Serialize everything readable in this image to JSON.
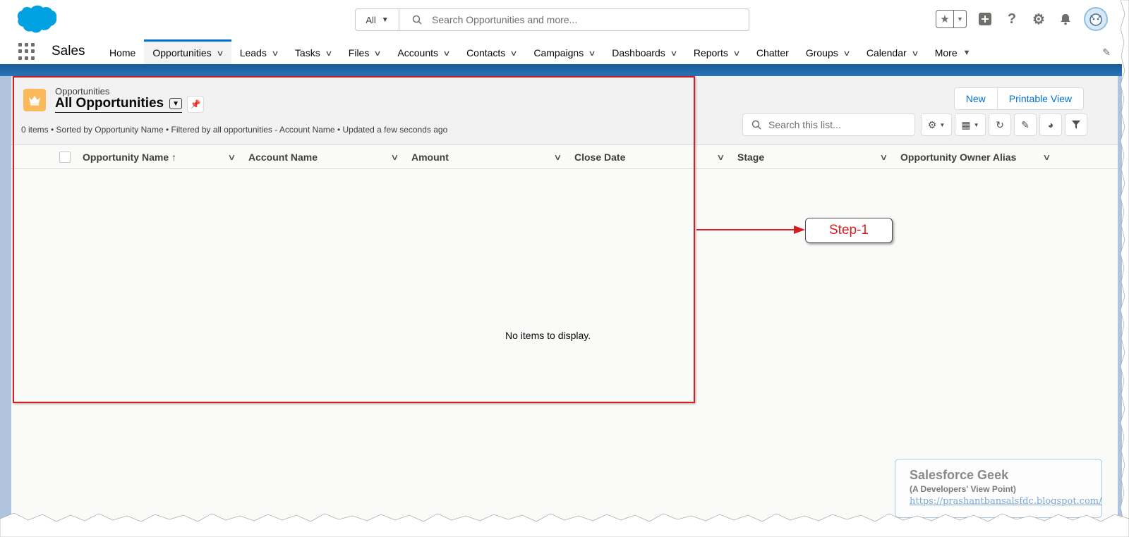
{
  "header": {
    "search_scope": "All",
    "search_placeholder": "Search Opportunities and more..."
  },
  "nav": {
    "app_name": "Sales",
    "items": [
      {
        "label": "Home",
        "has_menu": false
      },
      {
        "label": "Opportunities",
        "has_menu": true,
        "active": true
      },
      {
        "label": "Leads",
        "has_menu": true
      },
      {
        "label": "Tasks",
        "has_menu": true
      },
      {
        "label": "Files",
        "has_menu": true
      },
      {
        "label": "Accounts",
        "has_menu": true
      },
      {
        "label": "Contacts",
        "has_menu": true
      },
      {
        "label": "Campaigns",
        "has_menu": true
      },
      {
        "label": "Dashboards",
        "has_menu": true
      },
      {
        "label": "Reports",
        "has_menu": true
      },
      {
        "label": "Chatter",
        "has_menu": false
      },
      {
        "label": "Groups",
        "has_menu": true
      },
      {
        "label": "Calendar",
        "has_menu": true
      },
      {
        "label": "More",
        "has_menu": true
      }
    ]
  },
  "list_view": {
    "object_label": "Opportunities",
    "title": "All Opportunities",
    "info": "0 items • Sorted by Opportunity Name • Filtered by all opportunities - Account Name • Updated a few seconds ago",
    "new_label": "New",
    "printable_label": "Printable View",
    "search_placeholder": "Search this list...",
    "columns": [
      {
        "label": "Opportunity Name",
        "sort": "↑"
      },
      {
        "label": "Account Name"
      },
      {
        "label": "Amount"
      },
      {
        "label": "Close Date"
      },
      {
        "label": "Stage"
      },
      {
        "label": "Opportunity Owner Alias"
      }
    ],
    "empty_message": "No items to display."
  },
  "annotation": {
    "step_label": "Step-1"
  },
  "watermark": {
    "title": "Salesforce Geek",
    "subtitle": "(A Developers' View Point)",
    "url": "https://prashantbansalsfdc.blogspot.com/"
  },
  "colors": {
    "brand_blue": "#0070d2",
    "nav_band": "#1b5f9e",
    "annotation_red": "#d51e23",
    "object_icon": "#fcb95b"
  }
}
